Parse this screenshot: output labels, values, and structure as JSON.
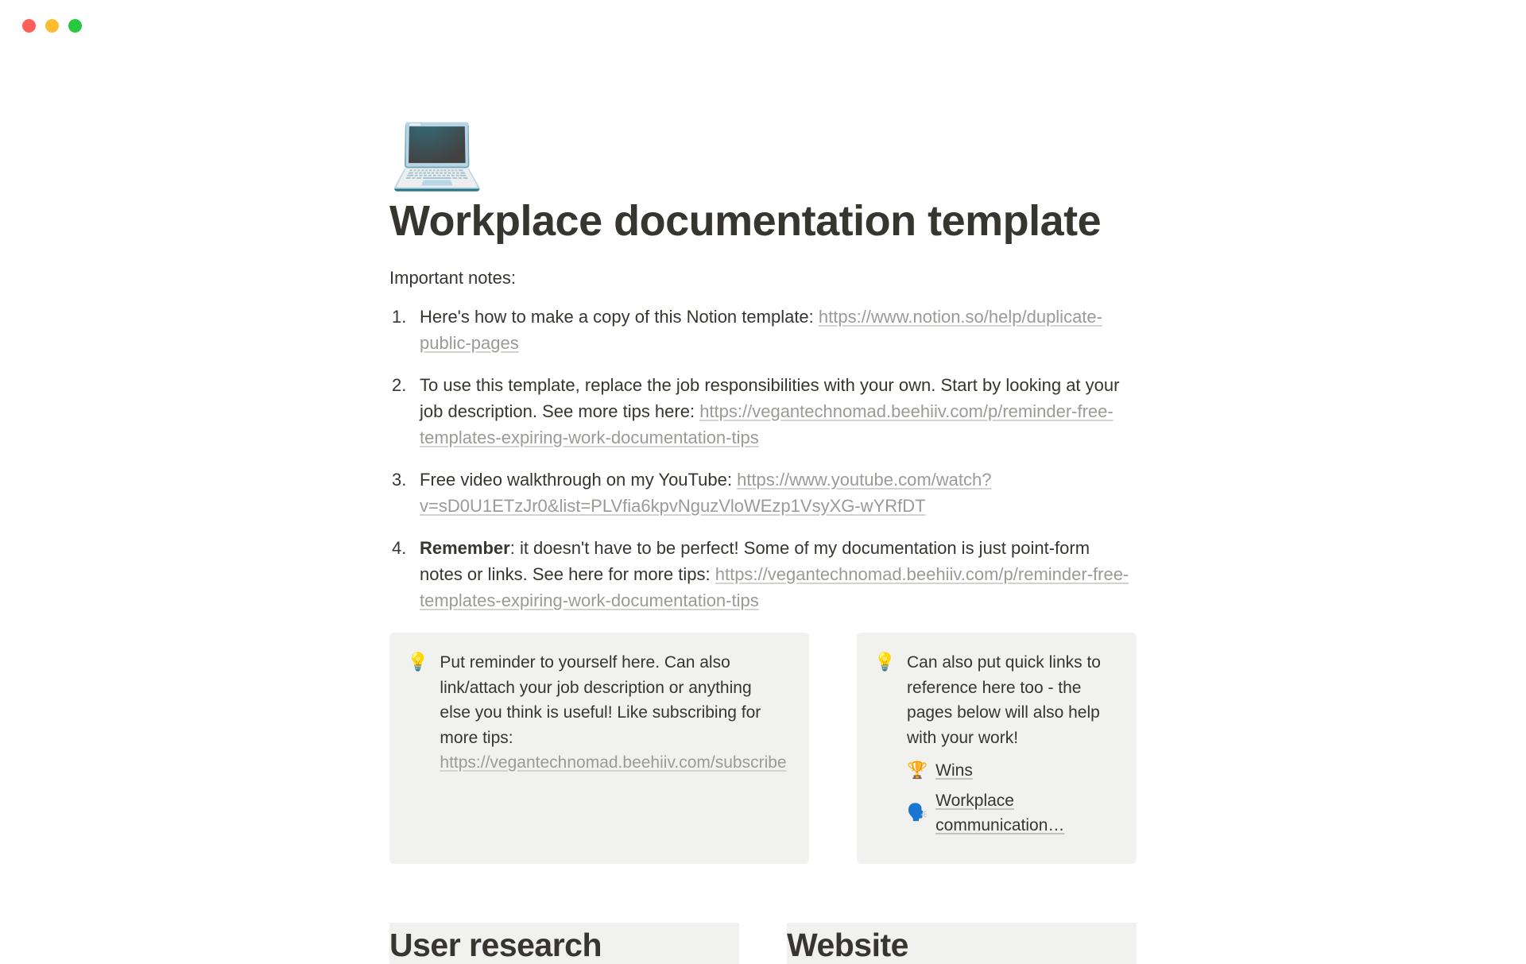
{
  "page": {
    "icon": "💻",
    "title": "Workplace documentation template",
    "intro": "Important notes:"
  },
  "notes": [
    {
      "text_before": "Here's how to make a copy of this Notion template: ",
      "link_text": "https://www.notion.so/help/duplicate-public-pages",
      "text_after": ""
    },
    {
      "text_before": "To use this template, replace the job responsibilities with your own. Start by looking at your job description. See more tips here: ",
      "link_text": "https://vegantechnomad.beehiiv.com/p/reminder-free-templates-expiring-work-documentation-tips",
      "text_after": ""
    },
    {
      "text_before": "Free video walkthrough on my YouTube: ",
      "link_text": "https://www.youtube.com/watch?v=sD0U1ETzJr0&list=PLVfia6kpvNguzVloWEzp1VsyXG-wYRfDT",
      "text_after": ""
    },
    {
      "bold_prefix": "Remember",
      "text_before": ": it doesn't have to be perfect! Some of my documentation is just point-form notes or links. See here for more tips: ",
      "link_text": "https://vegantechnomad.beehiiv.com/p/reminder-free-templates-expiring-work-documentation-tips",
      "text_after": ""
    }
  ],
  "callouts": {
    "left": {
      "icon": "💡",
      "text_before": "Put reminder to yourself here. Can also link/attach your job description or anything else you think is useful! Like subscribing for more tips: ",
      "link_text": "https://vegantechnomad.beehiiv.com/subscribe"
    },
    "right": {
      "icon": "💡",
      "text": "Can also put quick links to reference here too - the pages below will also help with your work!",
      "pages": [
        {
          "emoji": "🏆",
          "name": "Wins"
        },
        {
          "emoji": "🗣️",
          "name": "Workplace communication…"
        }
      ]
    }
  },
  "sections": {
    "left": "User research",
    "right": "Website"
  }
}
